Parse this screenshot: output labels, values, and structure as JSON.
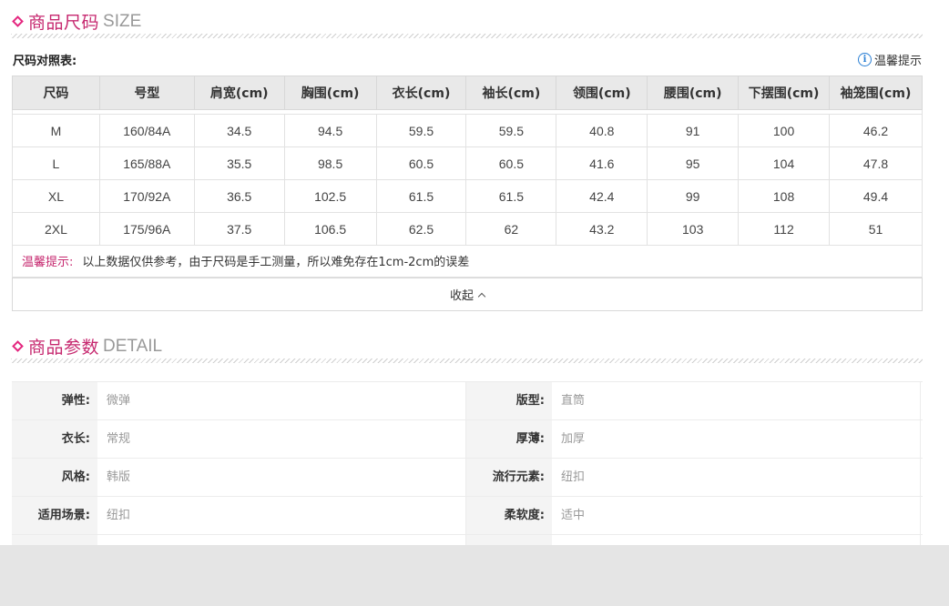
{
  "size_section": {
    "title_cn": "商品尺码",
    "title_en": "SIZE",
    "subtitle": "尺码对照表:",
    "tip_link": "温馨提示",
    "headers": [
      "尺码",
      "号型",
      "肩宽(cm)",
      "胸围(cm)",
      "衣长(cm)",
      "袖长(cm)",
      "领围(cm)",
      "腰围(cm)",
      "下摆围(cm)",
      "袖笼围(cm)"
    ],
    "rows": [
      [
        "M",
        "160/84A",
        "34.5",
        "94.5",
        "59.5",
        "59.5",
        "40.8",
        "91",
        "100",
        "46.2"
      ],
      [
        "L",
        "165/88A",
        "35.5",
        "98.5",
        "60.5",
        "60.5",
        "41.6",
        "95",
        "104",
        "47.8"
      ],
      [
        "XL",
        "170/92A",
        "36.5",
        "102.5",
        "61.5",
        "61.5",
        "42.4",
        "99",
        "108",
        "49.4"
      ],
      [
        "2XL",
        "175/96A",
        "37.5",
        "106.5",
        "62.5",
        "62",
        "43.2",
        "103",
        "112",
        "51"
      ]
    ],
    "note_label": "温馨提示:",
    "note_text": "以上数据仅供参考，由于尺码是手工测量，所以难免存在1cm-2cm的误差",
    "collapse_label": "收起"
  },
  "detail_section": {
    "title_cn": "商品参数",
    "title_en": "DETAIL",
    "params": [
      {
        "label": "弹性:",
        "value": "微弹"
      },
      {
        "label": "版型:",
        "value": "直筒"
      },
      {
        "label": "衣长:",
        "value": "常规"
      },
      {
        "label": "厚薄:",
        "value": "加厚"
      },
      {
        "label": "风格:",
        "value": "韩版"
      },
      {
        "label": "流行元素:",
        "value": "纽扣"
      },
      {
        "label": "适用场景:",
        "value": "纽扣"
      },
      {
        "label": "柔软度:",
        "value": "适中"
      }
    ]
  },
  "colors": {
    "accent": "#c6286f",
    "header_bg": "#e9e9e9",
    "label_bg": "#f4f4f4"
  }
}
